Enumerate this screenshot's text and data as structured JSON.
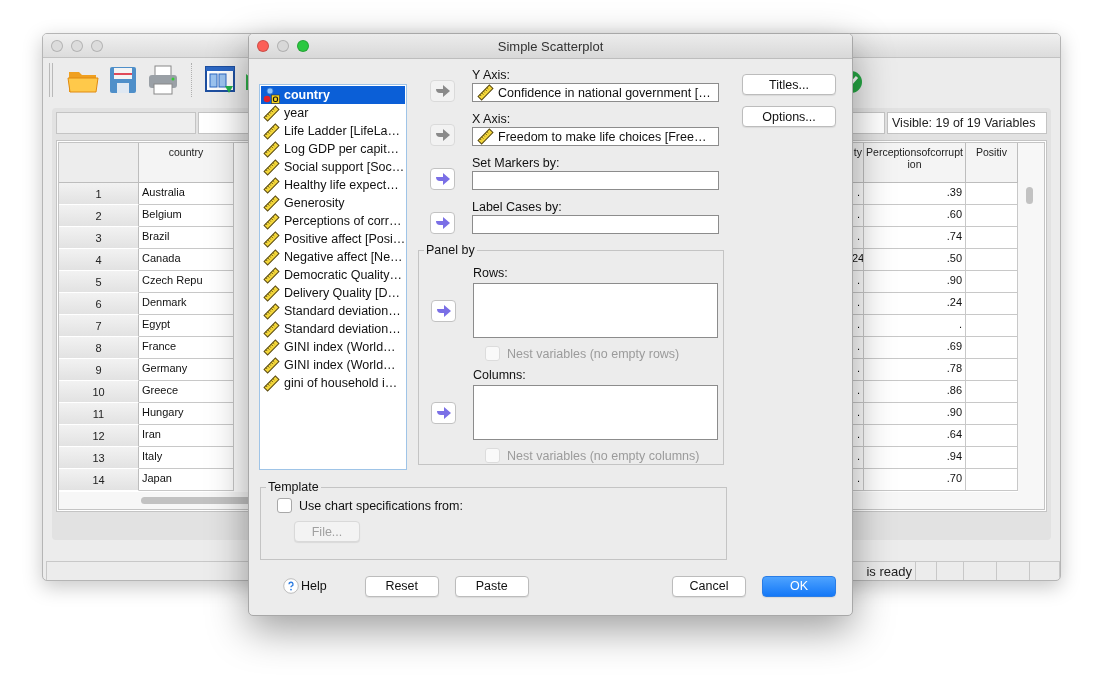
{
  "data_editor": {
    "visible_count": "Visible: 19 of 19 Variables",
    "columns": [
      "country",
      "ty",
      "Perceptionsofcorruption",
      "Positiv"
    ],
    "rows": [
      {
        "number": "1",
        "cells": [
          "Australia",
          ".",
          ".39"
        ]
      },
      {
        "number": "2",
        "cells": [
          "Belgium",
          ".",
          ".60"
        ]
      },
      {
        "number": "3",
        "cells": [
          "Brazil",
          ".",
          ".74"
        ]
      },
      {
        "number": "4",
        "cells": [
          "Canada",
          "24",
          ".50"
        ]
      },
      {
        "number": "5",
        "cells": [
          "Czech Repu",
          ".",
          ".90"
        ]
      },
      {
        "number": "6",
        "cells": [
          "Denmark",
          ".",
          ".24"
        ]
      },
      {
        "number": "7",
        "cells": [
          "Egypt",
          ".",
          "."
        ]
      },
      {
        "number": "8",
        "cells": [
          "France",
          ".",
          ".69"
        ]
      },
      {
        "number": "9",
        "cells": [
          "Germany",
          ".",
          ".78"
        ]
      },
      {
        "number": "10",
        "cells": [
          "Greece",
          ".",
          ".86"
        ]
      },
      {
        "number": "11",
        "cells": [
          "Hungary",
          ".",
          ".90"
        ]
      },
      {
        "number": "12",
        "cells": [
          "Iran",
          ".",
          ".64"
        ]
      },
      {
        "number": "13",
        "cells": [
          "Italy",
          ".",
          ".94"
        ]
      },
      {
        "number": "14",
        "cells": [
          "Japan",
          ".",
          ".70"
        ]
      }
    ],
    "status": "is ready"
  },
  "dialog": {
    "title": "Simple Scatterplot",
    "variables": [
      {
        "name": "country",
        "kind": "nominal",
        "selected": true
      },
      {
        "name": "year",
        "kind": "scale",
        "selected": false
      },
      {
        "name": "Life Ladder [LifeLa…",
        "kind": "scale",
        "selected": false
      },
      {
        "name": "Log GDP per capit…",
        "kind": "scale",
        "selected": false
      },
      {
        "name": "Social support [Soc…",
        "kind": "scale",
        "selected": false
      },
      {
        "name": "Healthy life expect…",
        "kind": "scale",
        "selected": false
      },
      {
        "name": "Generosity",
        "kind": "scale",
        "selected": false
      },
      {
        "name": "Perceptions of corr…",
        "kind": "scale",
        "selected": false
      },
      {
        "name": "Positive affect [Posi…",
        "kind": "scale",
        "selected": false
      },
      {
        "name": "Negative affect [Ne…",
        "kind": "scale",
        "selected": false
      },
      {
        "name": "Democratic Quality…",
        "kind": "scale",
        "selected": false
      },
      {
        "name": "Delivery Quality [D…",
        "kind": "scale",
        "selected": false
      },
      {
        "name": "Standard deviation…",
        "kind": "scale",
        "selected": false
      },
      {
        "name": "Standard deviation…",
        "kind": "scale",
        "selected": false
      },
      {
        "name": "GINI index (World…",
        "kind": "scale",
        "selected": false
      },
      {
        "name": "GINI index (World…",
        "kind": "scale",
        "selected": false
      },
      {
        "name": "gini of household i…",
        "kind": "scale",
        "selected": false
      }
    ],
    "targets": [
      {
        "label": "Y Axis:",
        "value": "Confidence in national government […",
        "arrow_enabled": false
      },
      {
        "label": "X Axis:",
        "value": "Freedom to make life choices [Free…",
        "arrow_enabled": false
      },
      {
        "label": "Set Markers by:",
        "arrow_enabled": true
      },
      {
        "label": "Label Cases by:",
        "arrow_enabled": true
      }
    ],
    "side_buttons": [
      "Titles...",
      "Options..."
    ],
    "panel_by": {
      "title": "Panel by",
      "groups": [
        {
          "label": "Rows:",
          "arrow_enabled": true,
          "nest": {
            "label": "Nest variables (no empty rows)",
            "checked": false,
            "disabled": true
          }
        },
        {
          "label": "Columns:",
          "arrow_enabled": true,
          "nest": {
            "label": "Nest variables (no empty columns)",
            "checked": false,
            "disabled": true
          }
        }
      ]
    },
    "template": {
      "title": "Template",
      "checkbox": {
        "label": "Use chart specifications from:",
        "checked": false
      },
      "file_button": {
        "label": "File...",
        "disabled": true
      }
    },
    "help": "Help",
    "left_buttons": [
      {
        "label": "Reset",
        "default": false
      },
      {
        "label": "Paste",
        "default": false
      }
    ],
    "right_buttons": [
      {
        "label": "Cancel",
        "default": false
      },
      {
        "label": "OK",
        "default": true
      }
    ]
  }
}
